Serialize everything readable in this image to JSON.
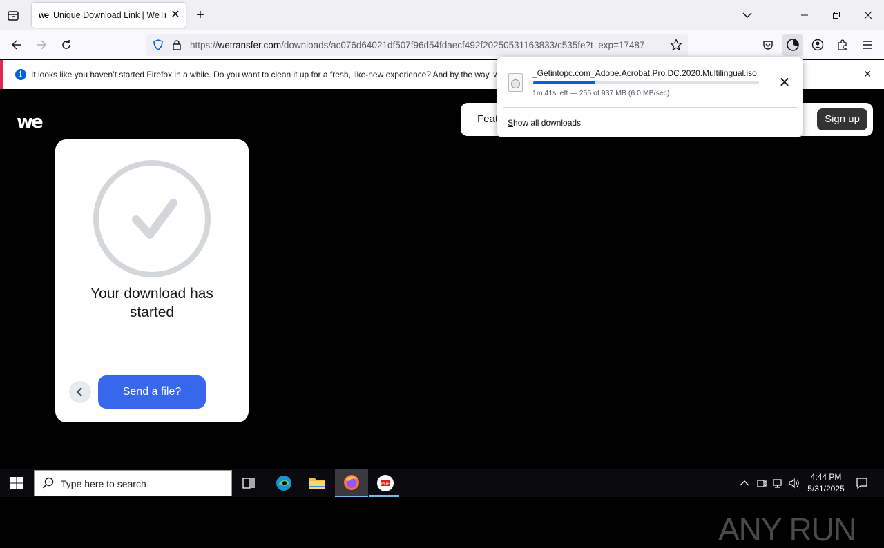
{
  "browser": {
    "tab_title": "Unique Download Link | WeTransfer",
    "url_prefix": "https://",
    "url_domain": "wetransfer.com",
    "url_path": "/downloads/ac076d64021df507f96d54fdaecf492f20250531163833/c535fe?t_exp=17487",
    "notification": "It looks like you haven’t started Firefox in a while. Do you want to clean it up for a fresh, like-new experience? And by the way, welcome back!"
  },
  "page": {
    "logo": "we",
    "nav_features": "Features",
    "signup_label": "Sign up",
    "card_title": "Your download has started",
    "send_label": "Send a file?"
  },
  "downloads": {
    "file_name": "_Getintopc.com_Adobe.Acrobat.Pro.DC.2020.Multilingual.iso",
    "status": "1m 41s left — 255 of 937 MB (6.0 MB/sec)",
    "progress": 0.272,
    "show_all": "Show all downloads"
  },
  "watermark": "ANY RUN",
  "taskbar": {
    "search_placeholder": "Type here to search",
    "time": "4:44 PM",
    "date": "5/31/2025"
  },
  "colors": {
    "accent_blue": "#3767ea",
    "firefox_blue": "#0061e0",
    "notification_stripe": "#e22850"
  }
}
